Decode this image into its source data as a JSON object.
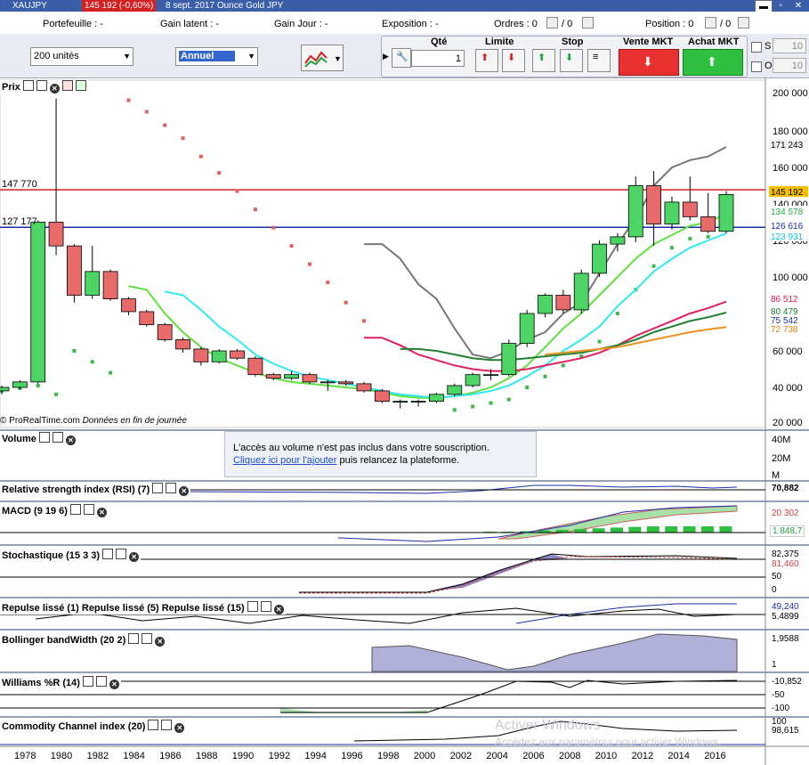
{
  "titlebar": {
    "symbol": "XAUJPY",
    "price": "145 192 (-0,60%)",
    "description": "8 sept. 2017 Ounce Gold JPY"
  },
  "strip": {
    "portefeuille": "Portefeuille : -",
    "gain_latent": "Gain latent : -",
    "gain_jour": "Gain Jour : -",
    "exposition": "Exposition : -",
    "ordres": "Ordres : 0",
    "ordres2": "/ 0",
    "position": "Position : 0",
    "position2": "/ 0"
  },
  "toolbar": {
    "quantity_select": "200 unités",
    "period_select": "Annuel",
    "qte_label": "Qté",
    "qte_value": "1",
    "limite_label": "Limite",
    "stop_label": "Stop",
    "vente_label": "Vente MKT",
    "achat_label": "Achat MKT",
    "s_label": "S",
    "o_label": "O",
    "s_value": "10",
    "o_value": "10"
  },
  "colors": {
    "up_candle": "#4cd464",
    "down_candle": "#e86a6a",
    "red_line": "#d82020",
    "blue_line": "#1a2fa8",
    "sar_red": "#e06060",
    "sar_green": "#3cb84c"
  },
  "price_panel": {
    "label": "Prix",
    "line_red_label": "147 770",
    "line_blue_label": "127 177",
    "source": "© ProRealTime.com",
    "source_note": "Données en fin de journée",
    "y_ticks": [
      "200 000",
      "180 000",
      "160 000",
      "140 000",
      "120 000",
      "100 000",
      "80 000",
      "60 000",
      "40 000",
      "20 000"
    ],
    "right_values": [
      {
        "v": "171 243",
        "bg": "#f4f4f4",
        "fg": "#000"
      },
      {
        "v": "145 192",
        "bg": "#f5c000",
        "fg": "#000"
      },
      {
        "v": "134 578",
        "bg": "#fff",
        "fg": "#20b040"
      },
      {
        "v": "126 616",
        "bg": "#fff",
        "fg": "#1a2fa8"
      },
      {
        "v": "123 931",
        "bg": "#fff",
        "fg": "#10c8e0"
      },
      {
        "v": "86 512",
        "bg": "#fff",
        "fg": "#d82050"
      },
      {
        "v": "80 479",
        "bg": "#fff",
        "fg": "#208030"
      },
      {
        "v": "75 542",
        "bg": "#fff",
        "fg": "#1a2fa8"
      },
      {
        "v": "72 738",
        "bg": "#fff",
        "fg": "#e08010"
      }
    ]
  },
  "chart_data": {
    "type": "candlestick",
    "title": "XAUJPY",
    "x": [
      "1977",
      "1978",
      "1979",
      "1980",
      "1981",
      "1982",
      "1983",
      "1984",
      "1985",
      "1986",
      "1987",
      "1988",
      "1989",
      "1990",
      "1991",
      "1992",
      "1993",
      "1994",
      "1995",
      "1996",
      "1997",
      "1998",
      "1999",
      "2000",
      "2001",
      "2002",
      "2003",
      "2004",
      "2005",
      "2006",
      "2007",
      "2008",
      "2009",
      "2010",
      "2011",
      "2012",
      "2013",
      "2014",
      "2015",
      "2016",
      "2017"
    ],
    "open": [
      38000,
      40000,
      43000,
      130000,
      117000,
      90000,
      103000,
      88000,
      81000,
      74000,
      66000,
      61000,
      54000,
      60000,
      56000,
      47000,
      45000,
      47000,
      43000,
      43000,
      42000,
      38000,
      32000,
      32000,
      32000,
      36000,
      41000,
      47000,
      47000,
      64000,
      80000,
      90000,
      82000,
      102000,
      118000,
      122000,
      150000,
      129000,
      141000,
      133000,
      125000
    ],
    "close": [
      40000,
      43000,
      130000,
      117000,
      90000,
      103000,
      88000,
      81000,
      74000,
      66000,
      61000,
      54000,
      60000,
      56000,
      47000,
      45000,
      47000,
      43000,
      43000,
      42000,
      38000,
      32000,
      32000,
      32000,
      36000,
      41000,
      47000,
      47000,
      64000,
      80000,
      90000,
      82000,
      102000,
      118000,
      122000,
      150000,
      129000,
      141000,
      133000,
      125000,
      145192
    ],
    "high": [
      41000,
      44000,
      131000,
      197000,
      118000,
      117000,
      104000,
      89000,
      82000,
      75000,
      67000,
      62000,
      61000,
      61000,
      57000,
      48000,
      49000,
      48000,
      44000,
      44000,
      43000,
      39000,
      33000,
      33000,
      37000,
      42000,
      48000,
      50000,
      66000,
      82000,
      91000,
      93000,
      104000,
      120000,
      124000,
      155000,
      158000,
      144000,
      155000,
      146000,
      147000
    ],
    "low": [
      36000,
      39000,
      42000,
      112000,
      86000,
      88000,
      87000,
      79000,
      73000,
      65000,
      59000,
      52000,
      53000,
      55000,
      46000,
      44000,
      44000,
      42000,
      38000,
      41000,
      37000,
      31000,
      28000,
      29000,
      31000,
      35000,
      40000,
      44000,
      46000,
      62000,
      78000,
      80000,
      80000,
      100000,
      114000,
      119000,
      117000,
      126000,
      131000,
      124000,
      124000
    ],
    "ylim": [
      18000,
      205000
    ],
    "series": [
      {
        "name": "",
        "color": "#777777",
        "values": [
          null,
          null,
          null,
          null,
          null,
          null,
          null,
          null,
          null,
          null,
          null,
          null,
          null,
          null,
          null,
          null,
          null,
          null,
          null,
          null,
          118000,
          118000,
          110000,
          96000,
          88000,
          72000,
          58000,
          56000,
          60000,
          66000,
          70000,
          80000,
          86000,
          102000,
          118000,
          132000,
          150000,
          160000,
          164000,
          166000,
          171243
        ]
      },
      {
        "name": "",
        "color": "#60e040",
        "values": [
          null,
          null,
          null,
          null,
          null,
          null,
          null,
          95000,
          93000,
          80000,
          70000,
          62000,
          56000,
          52000,
          48000,
          45000,
          43000,
          42000,
          41000,
          40000,
          39000,
          37000,
          35000,
          34000,
          34000,
          35000,
          37000,
          40000,
          45000,
          52000,
          62000,
          72000,
          80000,
          90000,
          100000,
          110000,
          118000,
          123000,
          128000,
          130000,
          134578
        ]
      },
      {
        "name": "",
        "color": "#30e8f0",
        "values": [
          null,
          null,
          null,
          null,
          null,
          null,
          null,
          null,
          null,
          92000,
          90000,
          82000,
          73000,
          66000,
          58000,
          53000,
          49000,
          46000,
          44000,
          42000,
          40000,
          38000,
          36000,
          35000,
          34000,
          35000,
          36000,
          38000,
          41000,
          46000,
          52000,
          60000,
          66000,
          73000,
          84000,
          93000,
          103000,
          110000,
          116000,
          120000,
          123931
        ]
      },
      {
        "name": "",
        "color": "#e02060",
        "values": [
          null,
          null,
          null,
          null,
          null,
          null,
          null,
          null,
          null,
          null,
          null,
          null,
          null,
          null,
          null,
          null,
          null,
          null,
          null,
          null,
          67000,
          67000,
          63000,
          58000,
          55000,
          52000,
          50000,
          49000,
          49000,
          50000,
          52000,
          54000,
          56000,
          59000,
          63000,
          68000,
          72000,
          76000,
          80000,
          83000,
          86512
        ]
      },
      {
        "name": "",
        "color": "#208030",
        "values": [
          null,
          null,
          null,
          null,
          null,
          null,
          null,
          null,
          null,
          null,
          null,
          null,
          null,
          null,
          null,
          null,
          null,
          null,
          null,
          null,
          null,
          null,
          61000,
          61000,
          60000,
          58000,
          56000,
          55000,
          55000,
          56000,
          57000,
          58000,
          59000,
          61000,
          63000,
          66000,
          70000,
          73000,
          76000,
          78000,
          80479
        ]
      },
      {
        "name": "",
        "color": "#f09020",
        "values": [
          null,
          null,
          null,
          null,
          null,
          null,
          null,
          null,
          null,
          null,
          null,
          null,
          null,
          null,
          null,
          null,
          null,
          null,
          null,
          null,
          null,
          null,
          null,
          null,
          null,
          null,
          null,
          null,
          null,
          null,
          58000,
          59000,
          60000,
          61000,
          62000,
          64000,
          66000,
          68000,
          70000,
          71500,
          72738
        ]
      }
    ],
    "hlines": [
      {
        "label": "147 770",
        "value": 147770,
        "color": "#d82020"
      },
      {
        "label": "127 177",
        "value": 127177,
        "color": "#1a2fa8"
      }
    ],
    "x_ticks": [
      "1978",
      "1980",
      "1982",
      "1984",
      "1986",
      "1988",
      "1990",
      "1992",
      "1994",
      "1996",
      "1998",
      "2000",
      "2002",
      "2004",
      "2006",
      "2008",
      "2010",
      "2012",
      "2014",
      "2016"
    ]
  },
  "volume_panel": {
    "label": "Volume",
    "ticks": [
      "40M",
      "20M",
      "M"
    ],
    "notice_line1": "L'accès au volume n'est pas inclus dans votre souscription.",
    "notice_link": "Cliquez ici pour l'ajouter",
    "notice_rest": "puis relancez la plateforme."
  },
  "rsi_panel": {
    "label": "Relative strength index (RSI) (7)",
    "value": "70,882"
  },
  "macd_panel": {
    "label": "MACD (9 19 6)",
    "value1": "20 302",
    "value2": "1 848,7"
  },
  "stoch_panel": {
    "label": "Stochastique (15 3 3)",
    "value1": "82,375",
    "value2": "81,460",
    "tick1": "50",
    "tick0": "0"
  },
  "repulse_panel": {
    "label": "Repulse lissé (1) Repulse lissé (5) Repulse lissé (15)",
    "value1": "49,240",
    "value2": "5,4899"
  },
  "bbw_panel": {
    "label": "Bollinger bandWidth (20 2)",
    "value": "1,9588",
    "tick": "1"
  },
  "williams_panel": {
    "label": "Williams %R (14)",
    "value": "-10,852",
    "tick1": "-50",
    "tick2": "-100"
  },
  "cci_panel": {
    "label": "Commodity Channel index (20)",
    "value": "98,615",
    "tick": "100"
  },
  "watermark": {
    "line1": "Activer Windows",
    "line2": "Accédez aux paramètres pour activer Windows."
  }
}
